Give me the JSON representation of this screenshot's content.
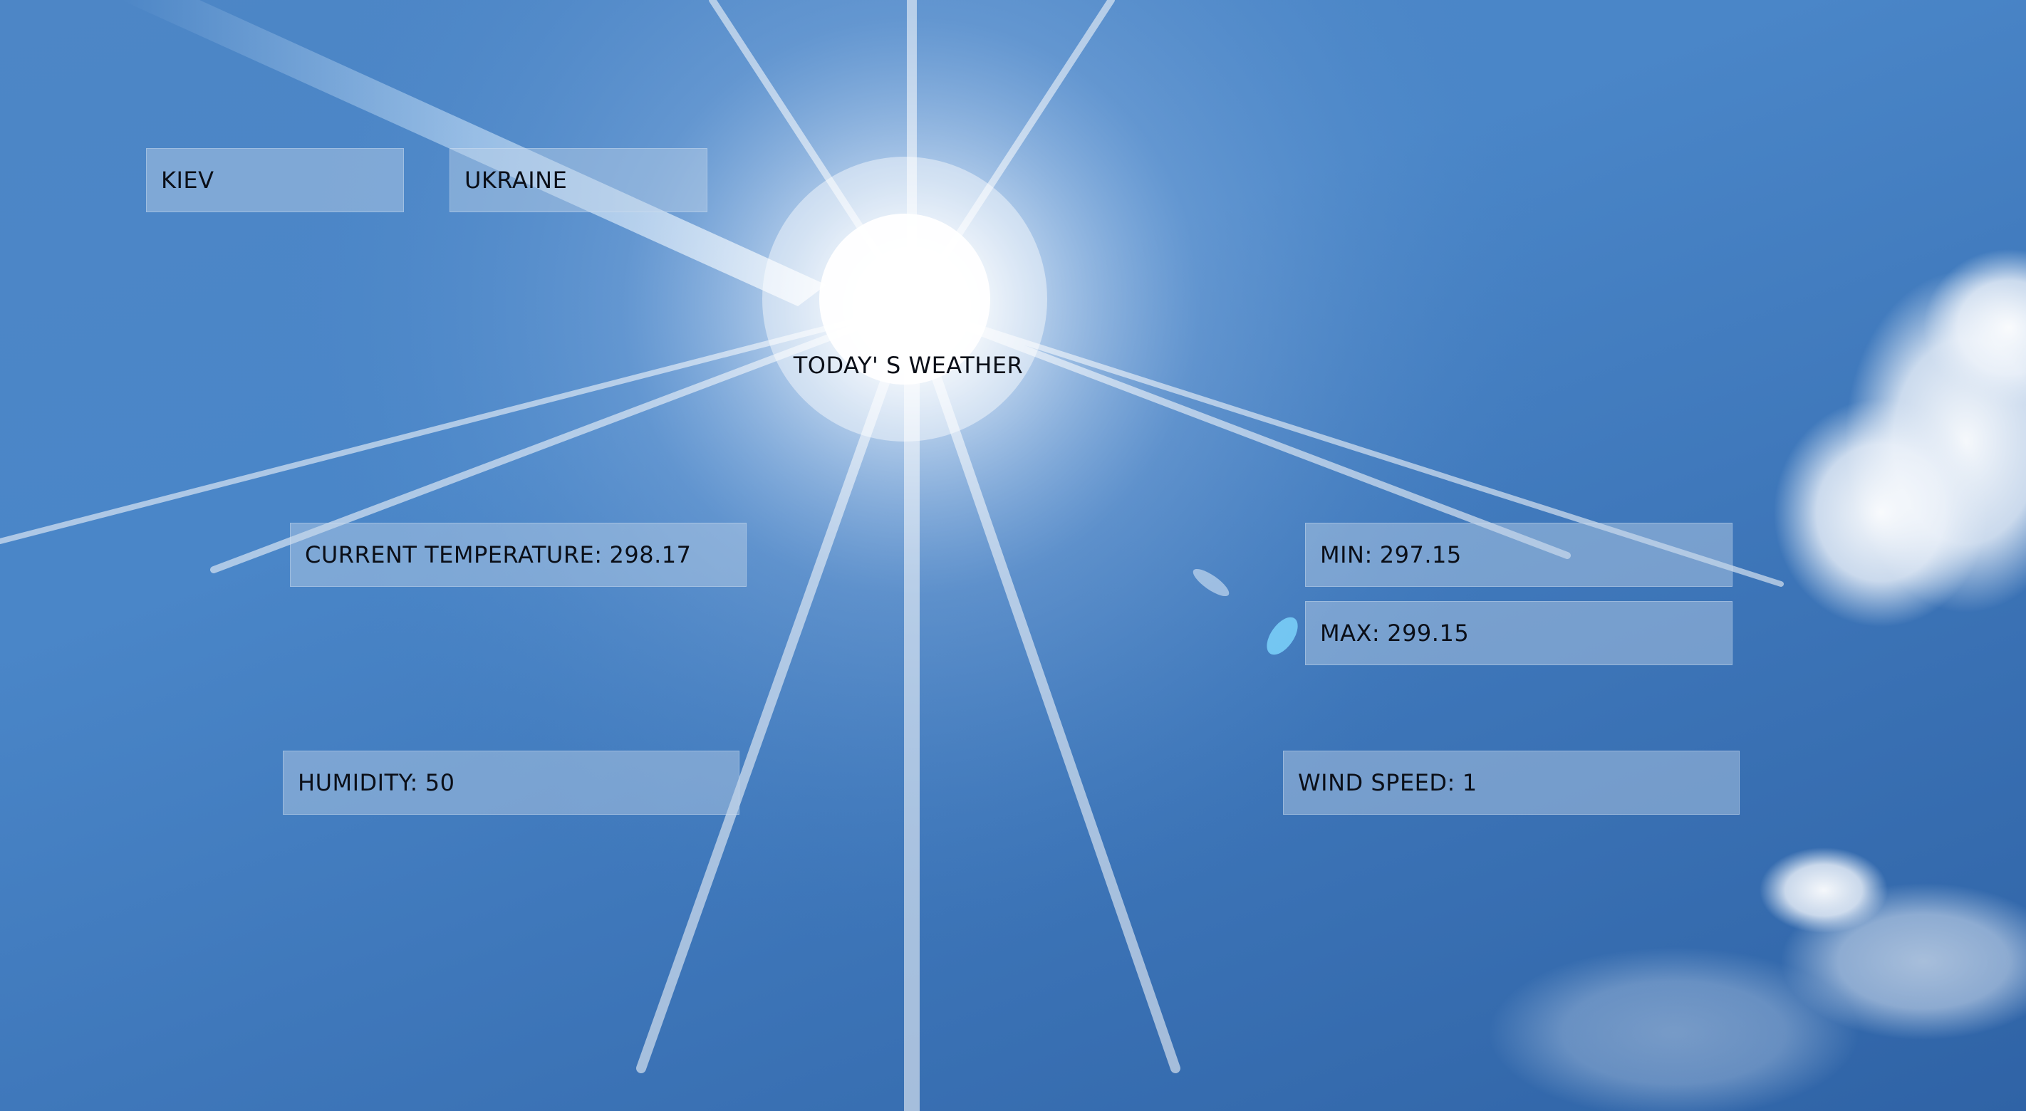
{
  "location": {
    "city": "KIEV",
    "country": "UKRAINE"
  },
  "heading": "TODAY' S WEATHER",
  "stats": {
    "current_temperature_label": "CURRENT TEMPERATURE: ",
    "current_temperature_value": "298.17",
    "min_label": "MIN: ",
    "min_value": "297.15",
    "max_label": "MAX: ",
    "max_value": "299.15",
    "humidity_label": "HUMIDITY: ",
    "humidity_value": "50",
    "wind_speed_label": "WIND SPEED: ",
    "wind_speed_value": "1"
  },
  "colors": {
    "sky": "#4a86c8",
    "panel": "#bed2e8",
    "text": "#0b0f18"
  }
}
